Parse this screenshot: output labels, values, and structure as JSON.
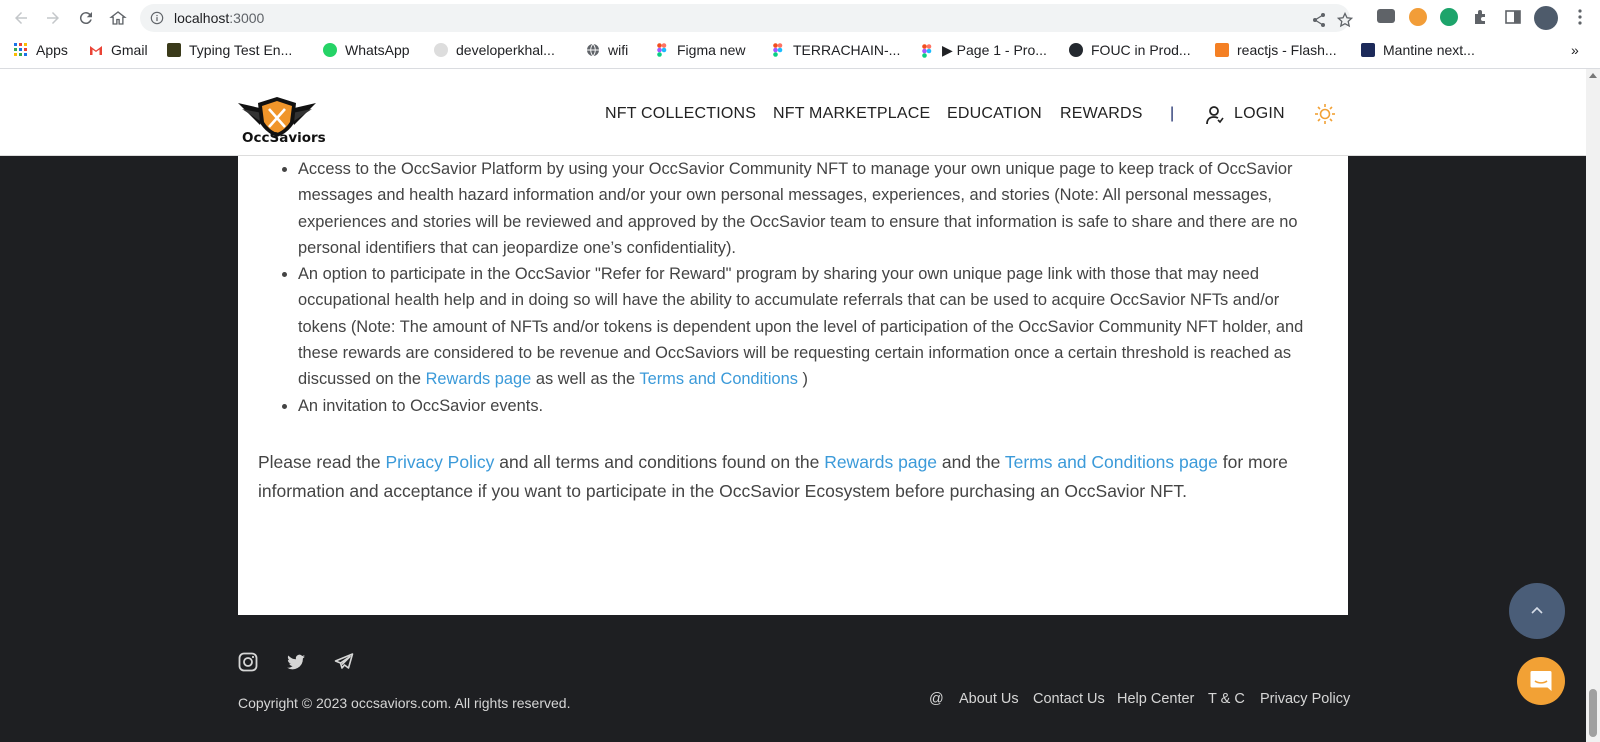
{
  "browser": {
    "url_host": "localhost",
    "url_port": ":3000",
    "bookmarks": [
      {
        "label": "Apps",
        "icon": "apps-grid-icon"
      },
      {
        "label": "Gmail",
        "icon": "gmail-icon"
      },
      {
        "label": "Typing Test En...",
        "icon": "typing-test-icon"
      },
      {
        "label": "WhatsApp",
        "icon": "whatsapp-icon"
      },
      {
        "label": "developerkhal...",
        "icon": "developer-icon"
      },
      {
        "label": "wifi",
        "icon": "globe-icon"
      },
      {
        "label": "Figma new",
        "icon": "figma-icon"
      },
      {
        "label": "TERRACHAIN-...",
        "icon": "figma-icon"
      },
      {
        "label": "▶ Page 1 - Pro...",
        "icon": "figma-icon"
      },
      {
        "label": "FOUC in Prod...",
        "icon": "github-icon"
      },
      {
        "label": "reactjs - Flash...",
        "icon": "stackoverflow-icon"
      },
      {
        "label": "Mantine next...",
        "icon": "react-icon"
      }
    ],
    "more_bookmarks": "»"
  },
  "header": {
    "logo_text": "OccSaviors",
    "nav": {
      "collections": "NFT COLLECTIONS",
      "marketplace": "NFT MARKETPLACE",
      "education": "EDUCATION",
      "rewards": "REWARDS",
      "divider": "|",
      "login": "LOGIN"
    }
  },
  "content": {
    "bullet1": "Access to the OccSavior Platform by using your OccSavior Community NFT to manage your own unique page to keep track of OccSavior messages and health hazard information and/or your own personal messages, experiences, and stories (Note: All personal messages, experiences and stories will be reviewed and approved by the OccSavior team to ensure that information is safe to share and there are no personal identifiers that can jeopardize one’s confidentiality).",
    "bullet2_a": "An option to participate in the OccSavior \"Refer for Reward\" program by sharing your own unique page link with those that may need occupational health help and in doing so will have the ability to accumulate referrals that can be used to acquire OccSavior NFTs and/or tokens (Note: The amount of NFTs and/or tokens is dependent upon the level of participation of the OccSavior Community NFT holder, and these rewards are considered to be revenue and OccSaviors will be requesting certain information once a certain threshold is reached as discussed on the ",
    "bullet2_link1": "Rewards page",
    "bullet2_b": " as well as the ",
    "bullet2_link2": "Terms and Conditions",
    "bullet2_c": " )",
    "bullet3": "An invitation to OccSavior events.",
    "para_a": "Please read the ",
    "para_link1": "Privacy Policy",
    "para_b": " and all terms and conditions found on the ",
    "para_link2": "Rewards page",
    "para_c": " and the ",
    "para_link3": "Terms and Conditions page",
    "para_d": " for more information and acceptance if you want to participate in the OccSavior Ecosystem before purchasing an OccSavior NFT."
  },
  "footer": {
    "copyright": "Copyright © 2023 occsaviors.com. All rights reserved.",
    "links": {
      "at": "@",
      "about": "About Us",
      "contact": "Contact Us",
      "help": "Help Center",
      "tc": "T & C",
      "privacy": "Privacy Policy"
    }
  },
  "colors": {
    "link": "#3b9ad9",
    "page_bg": "#1e1f22",
    "scroll_top_button": "#4a5d78",
    "chat_button": "#f2a135",
    "sun_icon": "#f2a135"
  }
}
